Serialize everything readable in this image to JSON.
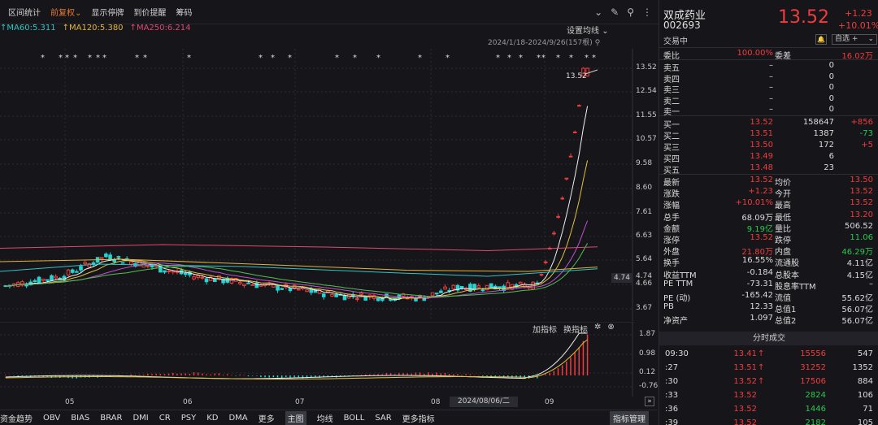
{
  "toolbar": {
    "items": [
      "区间统计",
      "前复权",
      "显示停牌",
      "到价提醒",
      "筹码"
    ],
    "active_index": 1,
    "dropdown_caret": "⌄",
    "icons": [
      "chevron-circle-icon",
      "brush-icon",
      "pin-icon",
      "more-icon"
    ]
  },
  "ma": {
    "ma60": "MA60:5.311",
    "ma120": "MA120:5.380",
    "ma250": "MA250:6.214",
    "up_arrow": "↑",
    "colors": {
      "ma60": "#2ec4c4",
      "ma120": "#e2b33c",
      "ma250": "#e04870"
    },
    "setting_label": "设置均线"
  },
  "range_label": "2024/1/18-2024/9/26(157根)",
  "price_axis": [
    "13.52",
    "12.54",
    "11.55",
    "10.57",
    "9.58",
    "8.60",
    "7.61",
    "6.63",
    "5.64",
    "4.74",
    "4.66",
    "3.67"
  ],
  "price_tag": "4.74",
  "last_price_label": "13.52",
  "sub_axis": [
    "1.87",
    "0.98",
    "0.12",
    "-0.76"
  ],
  "months": [
    "05",
    "06",
    "07",
    "08",
    "09"
  ],
  "date_tag": "2024/08/06/二",
  "sub_indicator": {
    "add": "加指标",
    "switch": "换指标"
  },
  "bottom_tabs": [
    "资金趋势",
    "OBV",
    "BIAS",
    "BRAR",
    "DMI",
    "CR",
    "PSY",
    "KD",
    "DMA",
    "更多",
    "主图",
    "均线",
    "BOLL",
    "SAR",
    "更多指标"
  ],
  "bottom_selected": "主图",
  "indicator_manager": "指标管理",
  "marker_glyph": "*",
  "chart_data": {
    "type": "candlestick",
    "title": "",
    "xlabel": "",
    "ylabel": "",
    "ylim": [
      3.67,
      13.52
    ],
    "x_ticks": [
      "05",
      "06",
      "07",
      "08",
      "09"
    ],
    "last_close": 13.52,
    "ma_latest": {
      "MA60": 5.311,
      "MA120": 5.38,
      "MA250": 6.214
    }
  },
  "stock": {
    "name": "双成药业",
    "code": "002693",
    "status": "交易中",
    "price": "13.52",
    "change": "+1.23",
    "change_pct": "+10.01%",
    "watch_label": "自选 +",
    "bell": "🔔"
  },
  "order_book": {
    "weibi_label": "委比",
    "weibi": "100.00%",
    "weicha_label": "委差",
    "weicha": "16.02万",
    "asks": [
      {
        "label": "卖五",
        "price": "–",
        "vol": "0"
      },
      {
        "label": "卖四",
        "price": "–",
        "vol": "0"
      },
      {
        "label": "卖三",
        "price": "–",
        "vol": "0"
      },
      {
        "label": "卖二",
        "price": "–",
        "vol": "0"
      },
      {
        "label": "卖一",
        "price": "–",
        "vol": "0"
      }
    ],
    "bids": [
      {
        "label": "买一",
        "price": "13.52",
        "vol": "158647",
        "chg": "+856"
      },
      {
        "label": "买二",
        "price": "13.51",
        "vol": "1387",
        "chg": "-73"
      },
      {
        "label": "买三",
        "price": "13.50",
        "vol": "172",
        "chg": "+5"
      },
      {
        "label": "买四",
        "price": "13.49",
        "vol": "6",
        "chg": ""
      },
      {
        "label": "买五",
        "price": "13.48",
        "vol": "23",
        "chg": ""
      }
    ]
  },
  "stats": [
    {
      "l1": "最新",
      "v1": "13.52",
      "c1": "red",
      "l2": "均价",
      "v2": "13.50",
      "c2": "red"
    },
    {
      "l1": "涨跌",
      "v1": "+1.23",
      "c1": "red",
      "l2": "今开",
      "v2": "13.52",
      "c2": "red"
    },
    {
      "l1": "涨幅",
      "v1": "+10.01%",
      "c1": "red",
      "l2": "最高",
      "v2": "13.52",
      "c2": "red"
    },
    {
      "l1": "总手",
      "v1": "68.09万",
      "c1": "white",
      "l2": "最低",
      "v2": "13.20",
      "c2": "red"
    },
    {
      "l1": "金额",
      "v1": "9.19亿",
      "c1": "green",
      "l2": "量比",
      "v2": "506.52",
      "c2": "white"
    },
    {
      "l1": "涨停",
      "v1": "13.52",
      "c1": "red",
      "l2": "跌停",
      "v2": "11.06",
      "c2": "green"
    },
    {
      "l1": "外盘",
      "v1": "21.80万",
      "c1": "red",
      "l2": "内盘",
      "v2": "46.29万",
      "c2": "green"
    },
    {
      "l1": "换手",
      "v1": "16.55%",
      "c1": "white",
      "l2": "流通股",
      "v2": "4.11亿",
      "c2": "white"
    },
    {
      "l1": "收益TTM",
      "v1": "-0.184",
      "c1": "white",
      "l2": "总股本",
      "v2": "4.15亿",
      "c2": "white"
    },
    {
      "l1": "PE TTM",
      "v1": "-73.31",
      "c1": "white",
      "l2": "股息率TTM",
      "v2": "–",
      "c2": "white"
    },
    {
      "l1": "PE (动)",
      "v1": "-165.42",
      "c1": "white",
      "l2": "流值",
      "v2": "55.62亿",
      "c2": "white"
    },
    {
      "l1": "PB",
      "v1": "12.33",
      "c1": "white",
      "l2": "总值1",
      "v2": "56.07亿",
      "c2": "white"
    },
    {
      "l1": "净资产",
      "v1": "1.097",
      "c1": "white",
      "l2": "总值2",
      "v2": "56.07亿",
      "c2": "white"
    }
  ],
  "fenshi": {
    "title": "分时成交",
    "rows": [
      {
        "t": "09:30",
        "p": "13.41",
        "a": "↑",
        "v": "15556",
        "n": "547",
        "vc": "red"
      },
      {
        "t": ":27",
        "p": "13.51",
        "a": "↑",
        "v": "31252",
        "n": "1352",
        "vc": "red"
      },
      {
        "t": ":30",
        "p": "13.52",
        "a": "↑",
        "v": "17506",
        "n": "884",
        "vc": "red"
      },
      {
        "t": ":33",
        "p": "13.52",
        "a": "",
        "v": "2824",
        "n": "106",
        "vc": "green"
      },
      {
        "t": ":36",
        "p": "13.52",
        "a": "",
        "v": "1446",
        "n": "71",
        "vc": "green"
      },
      {
        "t": ":39",
        "p": "13.52",
        "a": "",
        "v": "2182",
        "n": "105",
        "vc": "green"
      }
    ]
  }
}
